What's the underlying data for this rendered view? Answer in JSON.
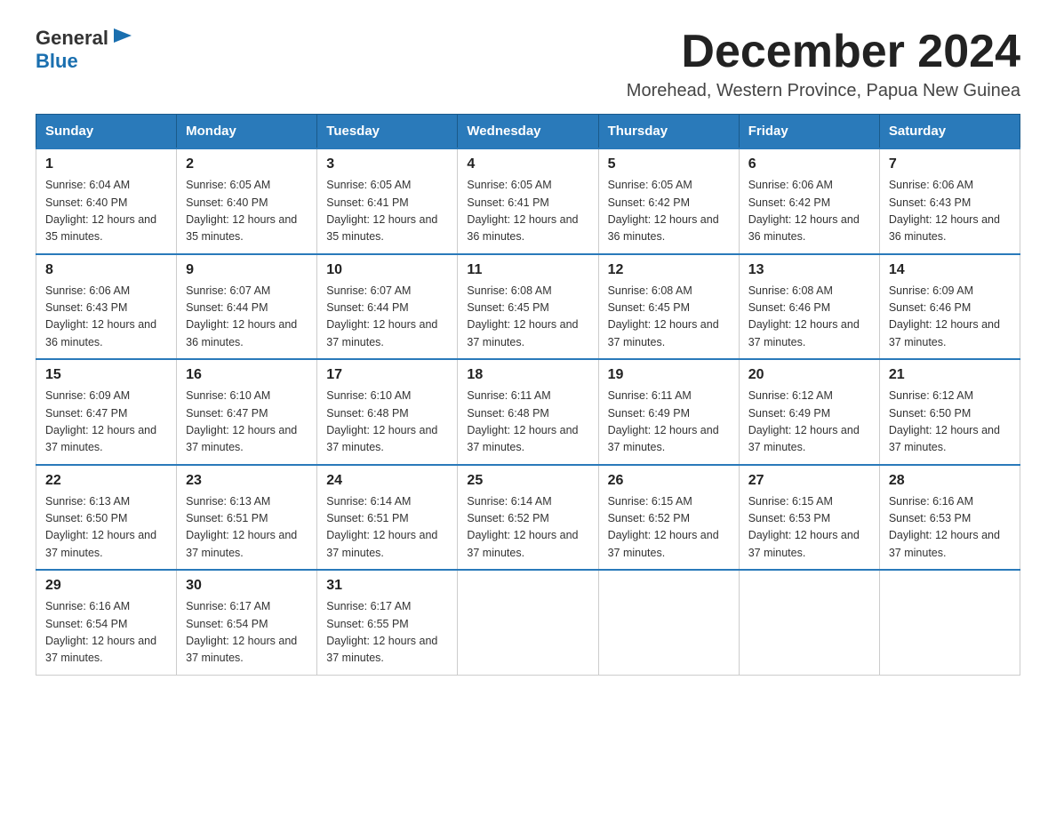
{
  "logo": {
    "text_general": "General",
    "text_blue": "Blue"
  },
  "title": "December 2024",
  "subtitle": "Morehead, Western Province, Papua New Guinea",
  "weekdays": [
    "Sunday",
    "Monday",
    "Tuesday",
    "Wednesday",
    "Thursday",
    "Friday",
    "Saturday"
  ],
  "weeks": [
    [
      {
        "day": "1",
        "sunrise": "6:04 AM",
        "sunset": "6:40 PM",
        "daylight": "12 hours and 35 minutes."
      },
      {
        "day": "2",
        "sunrise": "6:05 AM",
        "sunset": "6:40 PM",
        "daylight": "12 hours and 35 minutes."
      },
      {
        "day": "3",
        "sunrise": "6:05 AM",
        "sunset": "6:41 PM",
        "daylight": "12 hours and 35 minutes."
      },
      {
        "day": "4",
        "sunrise": "6:05 AM",
        "sunset": "6:41 PM",
        "daylight": "12 hours and 36 minutes."
      },
      {
        "day": "5",
        "sunrise": "6:05 AM",
        "sunset": "6:42 PM",
        "daylight": "12 hours and 36 minutes."
      },
      {
        "day": "6",
        "sunrise": "6:06 AM",
        "sunset": "6:42 PM",
        "daylight": "12 hours and 36 minutes."
      },
      {
        "day": "7",
        "sunrise": "6:06 AM",
        "sunset": "6:43 PM",
        "daylight": "12 hours and 36 minutes."
      }
    ],
    [
      {
        "day": "8",
        "sunrise": "6:06 AM",
        "sunset": "6:43 PM",
        "daylight": "12 hours and 36 minutes."
      },
      {
        "day": "9",
        "sunrise": "6:07 AM",
        "sunset": "6:44 PM",
        "daylight": "12 hours and 36 minutes."
      },
      {
        "day": "10",
        "sunrise": "6:07 AM",
        "sunset": "6:44 PM",
        "daylight": "12 hours and 37 minutes."
      },
      {
        "day": "11",
        "sunrise": "6:08 AM",
        "sunset": "6:45 PM",
        "daylight": "12 hours and 37 minutes."
      },
      {
        "day": "12",
        "sunrise": "6:08 AM",
        "sunset": "6:45 PM",
        "daylight": "12 hours and 37 minutes."
      },
      {
        "day": "13",
        "sunrise": "6:08 AM",
        "sunset": "6:46 PM",
        "daylight": "12 hours and 37 minutes."
      },
      {
        "day": "14",
        "sunrise": "6:09 AM",
        "sunset": "6:46 PM",
        "daylight": "12 hours and 37 minutes."
      }
    ],
    [
      {
        "day": "15",
        "sunrise": "6:09 AM",
        "sunset": "6:47 PM",
        "daylight": "12 hours and 37 minutes."
      },
      {
        "day": "16",
        "sunrise": "6:10 AM",
        "sunset": "6:47 PM",
        "daylight": "12 hours and 37 minutes."
      },
      {
        "day": "17",
        "sunrise": "6:10 AM",
        "sunset": "6:48 PM",
        "daylight": "12 hours and 37 minutes."
      },
      {
        "day": "18",
        "sunrise": "6:11 AM",
        "sunset": "6:48 PM",
        "daylight": "12 hours and 37 minutes."
      },
      {
        "day": "19",
        "sunrise": "6:11 AM",
        "sunset": "6:49 PM",
        "daylight": "12 hours and 37 minutes."
      },
      {
        "day": "20",
        "sunrise": "6:12 AM",
        "sunset": "6:49 PM",
        "daylight": "12 hours and 37 minutes."
      },
      {
        "day": "21",
        "sunrise": "6:12 AM",
        "sunset": "6:50 PM",
        "daylight": "12 hours and 37 minutes."
      }
    ],
    [
      {
        "day": "22",
        "sunrise": "6:13 AM",
        "sunset": "6:50 PM",
        "daylight": "12 hours and 37 minutes."
      },
      {
        "day": "23",
        "sunrise": "6:13 AM",
        "sunset": "6:51 PM",
        "daylight": "12 hours and 37 minutes."
      },
      {
        "day": "24",
        "sunrise": "6:14 AM",
        "sunset": "6:51 PM",
        "daylight": "12 hours and 37 minutes."
      },
      {
        "day": "25",
        "sunrise": "6:14 AM",
        "sunset": "6:52 PM",
        "daylight": "12 hours and 37 minutes."
      },
      {
        "day": "26",
        "sunrise": "6:15 AM",
        "sunset": "6:52 PM",
        "daylight": "12 hours and 37 minutes."
      },
      {
        "day": "27",
        "sunrise": "6:15 AM",
        "sunset": "6:53 PM",
        "daylight": "12 hours and 37 minutes."
      },
      {
        "day": "28",
        "sunrise": "6:16 AM",
        "sunset": "6:53 PM",
        "daylight": "12 hours and 37 minutes."
      }
    ],
    [
      {
        "day": "29",
        "sunrise": "6:16 AM",
        "sunset": "6:54 PM",
        "daylight": "12 hours and 37 minutes."
      },
      {
        "day": "30",
        "sunrise": "6:17 AM",
        "sunset": "6:54 PM",
        "daylight": "12 hours and 37 minutes."
      },
      {
        "day": "31",
        "sunrise": "6:17 AM",
        "sunset": "6:55 PM",
        "daylight": "12 hours and 37 minutes."
      },
      null,
      null,
      null,
      null
    ]
  ]
}
